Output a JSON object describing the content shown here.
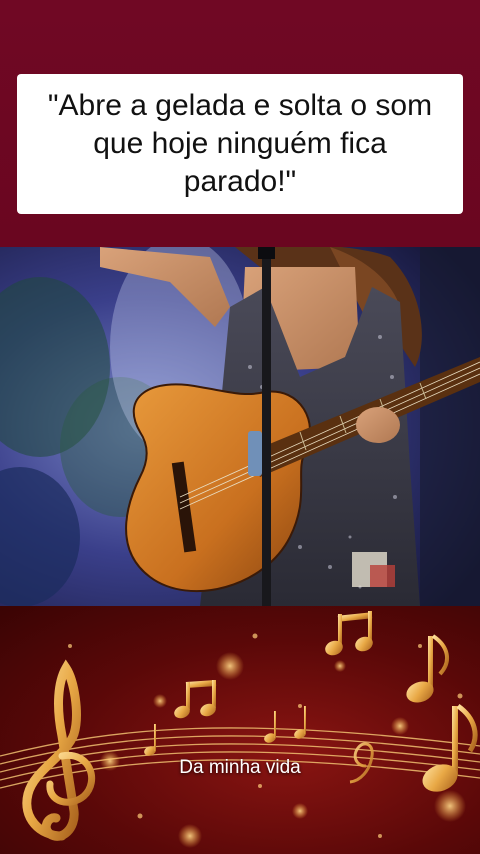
{
  "quote": {
    "text": "\"Abre a gelada e solta o som que hoje ninguém fica parado!\""
  },
  "video": {
    "scene": "performer-with-acoustic-guitar-and-microphone"
  },
  "background": {
    "theme": "golden-music-notes",
    "icons": [
      "treble-clef-icon",
      "music-note-icon",
      "beamed-notes-icon"
    ]
  },
  "caption": {
    "text": "Da minha vida"
  },
  "colors": {
    "band": "#6e0822",
    "card": "#ffffff",
    "gold": "#e8b45a"
  }
}
